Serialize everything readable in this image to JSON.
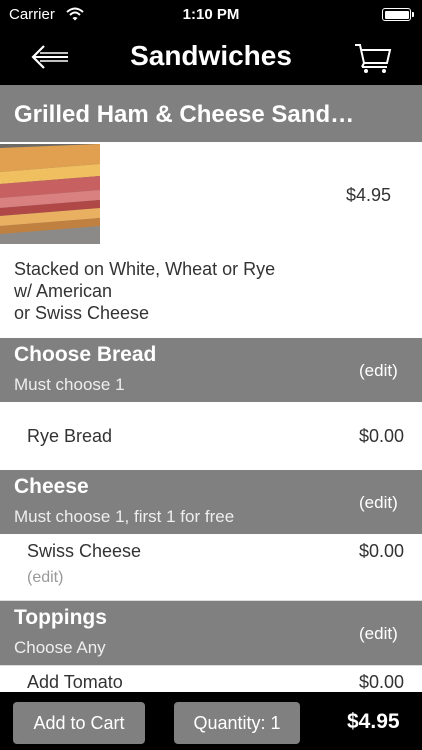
{
  "status_bar": {
    "carrier": "Carrier",
    "time": "1:10 PM"
  },
  "navbar": {
    "title": "Sandwiches"
  },
  "item": {
    "title": "Grilled Ham & Cheese Sand…",
    "price": "$4.95",
    "description": [
      "Stacked on White, Wheat or Rye",
      "w/ American",
      "or Swiss Cheese"
    ]
  },
  "sections": [
    {
      "name": "Choose Bread",
      "subtitle": "Must choose 1",
      "edit": "(edit)",
      "options": [
        {
          "label": "Rye Bread",
          "price": "$0.00"
        }
      ]
    },
    {
      "name": "Cheese",
      "subtitle": "Must choose 1, first 1 for free",
      "edit": "(edit)",
      "options": [
        {
          "label": "Swiss Cheese",
          "price": "$0.00",
          "edit": "(edit)"
        }
      ]
    },
    {
      "name": "Toppings",
      "subtitle": "Choose Any",
      "edit": "(edit)",
      "options": [
        {
          "label": "Add Tomato",
          "price": "$0.00"
        }
      ]
    }
  ],
  "bottom_bar": {
    "add_to_cart": "Add to Cart",
    "quantity": "Quantity: 1",
    "total": "$4.95"
  },
  "colors": {
    "header_bg": "#000000",
    "section_bg": "#808080",
    "button_bg": "#808080"
  }
}
